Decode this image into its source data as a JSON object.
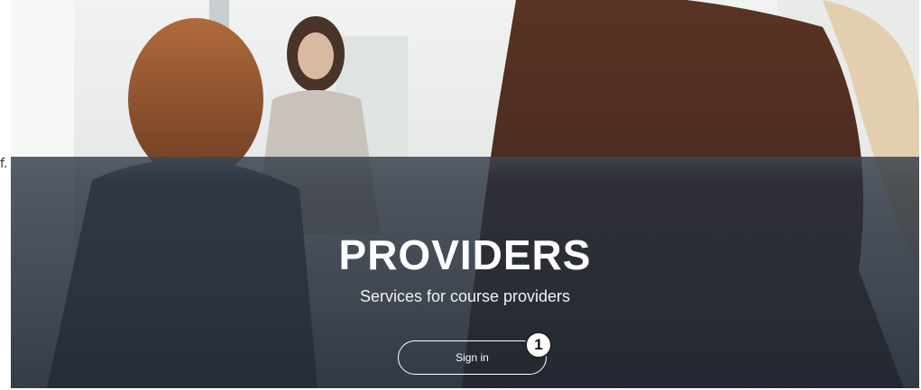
{
  "hero": {
    "title": "PROVIDERS",
    "subtitle": "Services for course providers",
    "signin_label": "Sign in",
    "step_badge": "1",
    "edge_mark": "f."
  },
  "colors": {
    "overlay": "#2a3240",
    "text": "#ffffff",
    "badge_bg": "#ffffff",
    "badge_border": "#222222"
  }
}
